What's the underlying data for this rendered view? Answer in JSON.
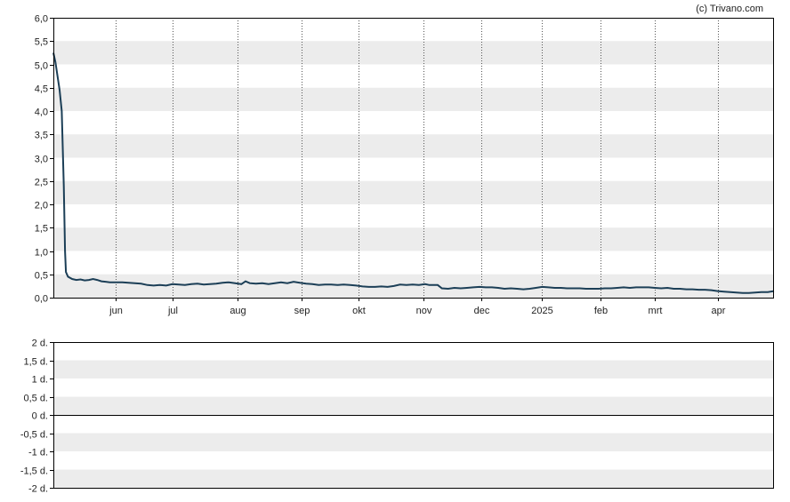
{
  "credit": "(c) Trivano.com",
  "colors": {
    "line": "#1c3f57",
    "band": "#ececec",
    "axis": "#000000",
    "vgrid": "#555555"
  },
  "chart_data": [
    {
      "type": "line",
      "title": "",
      "xlabel": "",
      "ylabel": "",
      "grid": "horizontal bands, dotted month lines",
      "ylim": [
        0,
        6
      ],
      "xlim_days": [
        0,
        345
      ],
      "x_tick_labels": [
        {
          "label": "jun",
          "day": 30
        },
        {
          "label": "jul",
          "day": 57
        },
        {
          "label": "aug",
          "day": 88
        },
        {
          "label": "sep",
          "day": 119
        },
        {
          "label": "okt",
          "day": 146
        },
        {
          "label": "nov",
          "day": 177
        },
        {
          "label": "dec",
          "day": 205
        },
        {
          "label": "2025",
          "day": 234
        },
        {
          "label": "feb",
          "day": 262
        },
        {
          "label": "mrt",
          "day": 288
        },
        {
          "label": "apr",
          "day": 318
        }
      ],
      "y_tick_labels": [
        "6,0",
        "5,5",
        "5,0",
        "4,5",
        "4,0",
        "3,5",
        "3,0",
        "2,5",
        "2,0",
        "1,5",
        "1,0",
        "0,5",
        "0,0"
      ],
      "y_tick_values": [
        6.0,
        5.5,
        5.0,
        4.5,
        4.0,
        3.5,
        3.0,
        2.5,
        2.0,
        1.5,
        1.0,
        0.5,
        0.0
      ],
      "series": [
        {
          "name": "",
          "points": [
            [
              0,
              5.25
            ],
            [
              1,
              5.05
            ],
            [
              3,
              4.45
            ],
            [
              4,
              4.0
            ],
            [
              5,
              2.4
            ],
            [
              5.6,
              1.0
            ],
            [
              6,
              0.55
            ],
            [
              7,
              0.45
            ],
            [
              9,
              0.4
            ],
            [
              11,
              0.38
            ],
            [
              13,
              0.39
            ],
            [
              15,
              0.37
            ],
            [
              17,
              0.38
            ],
            [
              19,
              0.4
            ],
            [
              21,
              0.38
            ],
            [
              23,
              0.35
            ],
            [
              25,
              0.34
            ],
            [
              27,
              0.33
            ],
            [
              30,
              0.33
            ],
            [
              33,
              0.33
            ],
            [
              36,
              0.32
            ],
            [
              39,
              0.31
            ],
            [
              42,
              0.3
            ],
            [
              45,
              0.27
            ],
            [
              48,
              0.26
            ],
            [
              51,
              0.27
            ],
            [
              54,
              0.26
            ],
            [
              57,
              0.29
            ],
            [
              60,
              0.28
            ],
            [
              63,
              0.27
            ],
            [
              66,
              0.29
            ],
            [
              69,
              0.3
            ],
            [
              72,
              0.28
            ],
            [
              75,
              0.29
            ],
            [
              78,
              0.3
            ],
            [
              81,
              0.32
            ],
            [
              84,
              0.33
            ],
            [
              87,
              0.31
            ],
            [
              90,
              0.29
            ],
            [
              92,
              0.35
            ],
            [
              94,
              0.31
            ],
            [
              97,
              0.3
            ],
            [
              100,
              0.31
            ],
            [
              103,
              0.29
            ],
            [
              106,
              0.31
            ],
            [
              109,
              0.33
            ],
            [
              112,
              0.31
            ],
            [
              115,
              0.34
            ],
            [
              118,
              0.32
            ],
            [
              121,
              0.3
            ],
            [
              124,
              0.29
            ],
            [
              127,
              0.27
            ],
            [
              130,
              0.28
            ],
            [
              133,
              0.28
            ],
            [
              136,
              0.27
            ],
            [
              139,
              0.28
            ],
            [
              142,
              0.27
            ],
            [
              145,
              0.26
            ],
            [
              148,
              0.24
            ],
            [
              151,
              0.23
            ],
            [
              154,
              0.23
            ],
            [
              157,
              0.24
            ],
            [
              160,
              0.23
            ],
            [
              163,
              0.25
            ],
            [
              166,
              0.28
            ],
            [
              169,
              0.27
            ],
            [
              172,
              0.28
            ],
            [
              175,
              0.27
            ],
            [
              178,
              0.29
            ],
            [
              180,
              0.27
            ],
            [
              184,
              0.27
            ],
            [
              186,
              0.2
            ],
            [
              189,
              0.19
            ],
            [
              192,
              0.21
            ],
            [
              195,
              0.2
            ],
            [
              198,
              0.21
            ],
            [
              201,
              0.22
            ],
            [
              204,
              0.23
            ],
            [
              207,
              0.22
            ],
            [
              210,
              0.22
            ],
            [
              213,
              0.21
            ],
            [
              216,
              0.19
            ],
            [
              219,
              0.2
            ],
            [
              222,
              0.19
            ],
            [
              225,
              0.18
            ],
            [
              228,
              0.19
            ],
            [
              231,
              0.21
            ],
            [
              234,
              0.23
            ],
            [
              237,
              0.22
            ],
            [
              240,
              0.21
            ],
            [
              243,
              0.21
            ],
            [
              246,
              0.2
            ],
            [
              249,
              0.2
            ],
            [
              252,
              0.2
            ],
            [
              255,
              0.19
            ],
            [
              258,
              0.19
            ],
            [
              261,
              0.19
            ],
            [
              264,
              0.2
            ],
            [
              267,
              0.2
            ],
            [
              270,
              0.21
            ],
            [
              273,
              0.22
            ],
            [
              276,
              0.21
            ],
            [
              279,
              0.22
            ],
            [
              282,
              0.22
            ],
            [
              285,
              0.22
            ],
            [
              288,
              0.21
            ],
            [
              291,
              0.2
            ],
            [
              294,
              0.21
            ],
            [
              297,
              0.19
            ],
            [
              300,
              0.19
            ],
            [
              303,
              0.18
            ],
            [
              306,
              0.18
            ],
            [
              309,
              0.17
            ],
            [
              312,
              0.17
            ],
            [
              315,
              0.16
            ],
            [
              318,
              0.14
            ],
            [
              321,
              0.13
            ],
            [
              324,
              0.12
            ],
            [
              327,
              0.11
            ],
            [
              330,
              0.1
            ],
            [
              333,
              0.1
            ],
            [
              336,
              0.11
            ],
            [
              339,
              0.12
            ],
            [
              342,
              0.12
            ],
            [
              345,
              0.14
            ]
          ]
        }
      ]
    },
    {
      "type": "line",
      "title": "",
      "ylim": [
        -2,
        2
      ],
      "grid": "horizontal bands",
      "y_tick_labels": [
        "2 d.",
        "1,5 d.",
        "1 d.",
        "0,5 d.",
        "0 d.",
        "-0,5 d.",
        "-1 d.",
        "-1,5 d.",
        "-2 d."
      ],
      "y_tick_values": [
        2,
        1.5,
        1,
        0.5,
        0,
        -0.5,
        -1,
        -1.5,
        -2
      ],
      "series": []
    }
  ]
}
